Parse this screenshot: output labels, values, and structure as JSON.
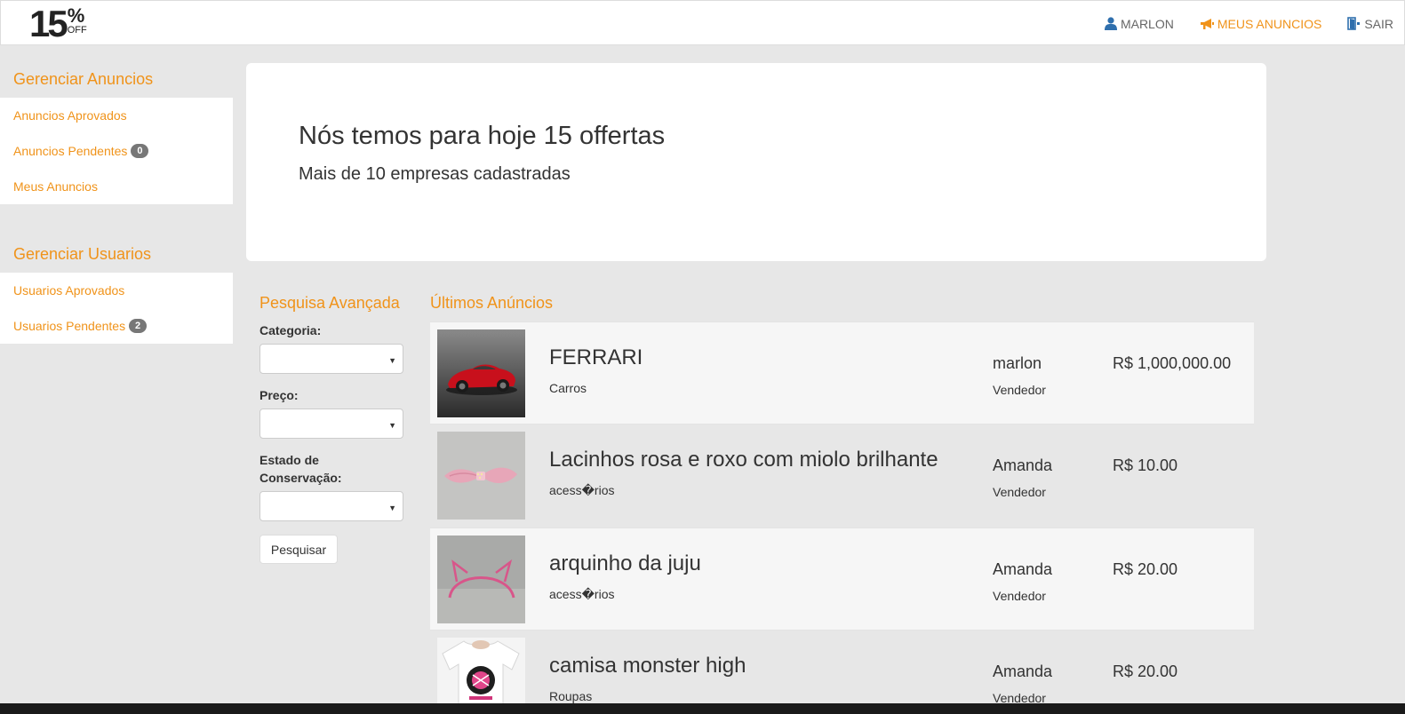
{
  "brand": {
    "number": "15",
    "percent": "%",
    "off": "OFF"
  },
  "nav": {
    "user": "MARLON",
    "my_ads": "MEUS ANUNCIOS",
    "exit": "SAIR"
  },
  "sidebar": {
    "ads_title": "Gerenciar Anuncios",
    "ads_items": [
      {
        "label": "Anuncios Aprovados"
      },
      {
        "label": "Anuncios Pendentes",
        "badge": "0"
      },
      {
        "label": "Meus Anuncios"
      }
    ],
    "users_title": "Gerenciar Usuarios",
    "users_items": [
      {
        "label": "Usuarios Aprovados"
      },
      {
        "label": "Usuarios Pendentes",
        "badge": "2"
      }
    ]
  },
  "jumbotron": {
    "title": "Nós temos para hoje 15 offertas",
    "subtitle": "Mais de 10 empresas cadastradas"
  },
  "search": {
    "title": "Pesquisa Avançada",
    "category_label": "Categoria:",
    "category_value": "",
    "price_label": "Preço:",
    "price_value": "",
    "condition_label_1": "Estado de",
    "condition_label_2": "Conservação:",
    "condition_value": "",
    "button": "Pesquisar"
  },
  "listings": {
    "title": "Últimos Anúncios",
    "ads": [
      {
        "title": "FERRARI",
        "category": "Carros",
        "seller": "marlon",
        "role": "Vendedor",
        "price": "R$ 1,000,000.00"
      },
      {
        "title": "Lacinhos rosa e roxo com miolo brilhante",
        "category": "acess�rios",
        "seller": "Amanda",
        "role": "Vendedor",
        "price": "R$ 10.00"
      },
      {
        "title": "arquinho da juju",
        "category": "acess�rios",
        "seller": "Amanda",
        "role": "Vendedor",
        "price": "R$ 20.00"
      },
      {
        "title": "camisa monster high",
        "category": "Roupas",
        "seller": "Amanda",
        "role": "Vendedor",
        "price": "R$ 20.00"
      }
    ]
  },
  "colors": {
    "accent": "#f0931a",
    "badge": "#777777",
    "nav_icon_blue": "#2f6fad"
  }
}
